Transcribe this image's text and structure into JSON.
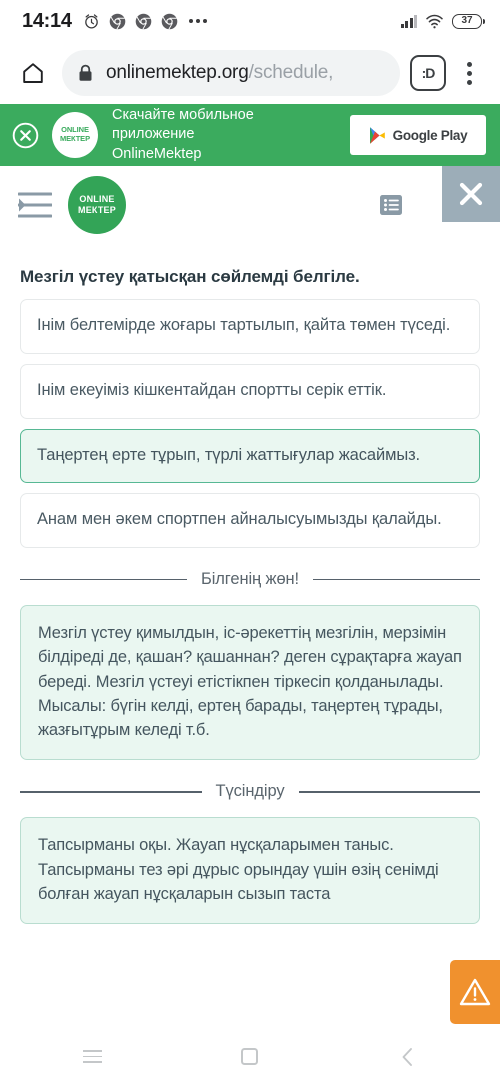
{
  "status_bar": {
    "time": "14:14",
    "battery_level": "37",
    "icons_left": [
      "alarm-icon",
      "chrome-icon",
      "chrome-icon",
      "chrome-icon",
      "more-dots-icon"
    ],
    "icons_right": [
      "signal-icon",
      "wifi-icon",
      "battery-icon"
    ]
  },
  "browser": {
    "home_icon": "home-icon",
    "lock_icon": "lock-icon",
    "url_domain": "onlinemektep.org",
    "url_path": "/schedule,",
    "smiley_label": ":D",
    "menu_icon": "overflow-menu-icon"
  },
  "promo": {
    "close_icon": "close-circle-icon",
    "logo_line1": "ONLINE",
    "logo_line2": "МЕКТЕР",
    "text_line1": "Скачайте мобильное приложение",
    "text_line2": "OnlineMektep",
    "store_button": "Google Play",
    "background_color": "#3bab5e"
  },
  "site_header": {
    "menu_icon": "indent-menu-icon",
    "logo_line1": "ONLINE",
    "logo_line2": "МЕКТЕР",
    "list_icon": "list-icon",
    "close_icon": "close-x-icon",
    "close_bg_color": "#9cadb8",
    "logo_color": "#33a457"
  },
  "task": {
    "title": "Мезгіл үстеу қатысқан сөйлемді белгіле.",
    "options": [
      {
        "text": "Інім белтемірде жоғары тартылып, қайта төмен түседі.",
        "selected": false
      },
      {
        "text": "Інім екеуіміз кішкентайдан спортты серік еттік.",
        "selected": false
      },
      {
        "text": "Таңертең ерте тұрып, түрлі жаттығулар жасаймыз.",
        "selected": true
      },
      {
        "text": "Анам мен әкем спортпен айналысуымызды қалайды.",
        "selected": false
      }
    ],
    "selected_border_color": "#57b894",
    "selected_bg_color": "#eaf7f1"
  },
  "know_section": {
    "divider_label": "Білгенің жөн!",
    "body": "Мезгіл үстеу қимылдын, іс-әрекеттің мезгілін, мерзімін білдіреді де, қашан? қашаннан? деген сұрақтарға жауап береді. Мезгіл үстеуі етістікпен тіркесіп қолданылады. Мысалы: бүгін келді, ертең барады, таңертең тұрады, жазғытұрым келеді т.б."
  },
  "explain_section": {
    "divider_label": "Түсіндіру",
    "body": "Тапсырманы оқы. Жауап нұсқаларымен таныс. Тапсырманы тез әрі дұрыс орындау үшін өзің сенімді болған жауап нұсқаларын сызып таста"
  },
  "warning_fab": {
    "icon": "warning-triangle-icon",
    "color": "#f0912e"
  },
  "nav_bar": {
    "recents_icon": "recents-icon",
    "home_icon": "home-square-icon",
    "back_icon": "back-chevron-icon"
  }
}
